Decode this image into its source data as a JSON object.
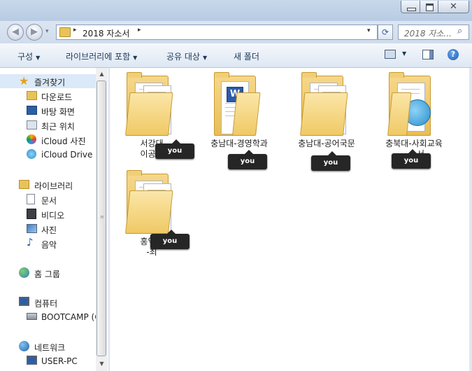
{
  "window": {
    "close_glyph": "✕"
  },
  "navigation": {
    "back_glyph": "◀",
    "forward_glyph": "▶",
    "history_glyph": "▾",
    "address": {
      "crumb_arrow": "▸",
      "path": "2018 자소서",
      "dropdown_glyph": "▾"
    },
    "refresh_glyph": "⟳",
    "search": {
      "placeholder": "2018 자소...",
      "icon": "search-icon"
    }
  },
  "command_bar": {
    "items": [
      {
        "label": "구성",
        "has_dropdown": true
      },
      {
        "label": "라이브러리에 포함",
        "has_dropdown": true
      },
      {
        "label": "공유 대상",
        "has_dropdown": true
      },
      {
        "label": "새 폴더",
        "has_dropdown": false
      }
    ],
    "dropdown_glyph": "▼",
    "help_label": "?"
  },
  "sidebar": {
    "favorites": {
      "label": "즐겨찾기",
      "icon": "star-icon",
      "items": [
        {
          "label": "다운로드",
          "icon": "download-icon"
        },
        {
          "label": "바탕 화면",
          "icon": "desktop-icon"
        },
        {
          "label": "최근 위치",
          "icon": "recent-places-icon"
        },
        {
          "label": "iCloud 사진",
          "icon": "icloud-photos-icon"
        },
        {
          "label": "iCloud Drive",
          "icon": "icloud-drive-icon"
        }
      ]
    },
    "libraries": {
      "label": "라이브러리",
      "icon": "library-icon",
      "items": [
        {
          "label": "문서",
          "icon": "documents-icon"
        },
        {
          "label": "비디오",
          "icon": "video-icon"
        },
        {
          "label": "사진",
          "icon": "pictures-icon"
        },
        {
          "label": "음악",
          "icon": "music-icon"
        }
      ]
    },
    "homegroup": {
      "label": "홈 그룹",
      "icon": "homegroup-icon"
    },
    "computer": {
      "label": "컴퓨터",
      "icon": "computer-icon",
      "items": [
        {
          "label": "BOOTCAMP (C",
          "icon": "drive-icon"
        }
      ]
    },
    "network": {
      "label": "네트워크",
      "icon": "network-icon",
      "items": [
        {
          "label": "USER-PC",
          "icon": "pc-icon"
        }
      ]
    },
    "scroll": {
      "up": "▲",
      "down": "▼",
      "grip": "≡"
    }
  },
  "content": {
    "folders": [
      {
        "line1": "서강대",
        "line2": "이공계",
        "overlay": "you",
        "preview": "document"
      },
      {
        "line1": "충남대-경영학과",
        "line2": "",
        "overlay": "you",
        "preview": "word"
      },
      {
        "line1": "충남대-공어국문",
        "line2": "",
        "overlay": "you",
        "preview": "document"
      },
      {
        "line1": "충북대-사회교육",
        "line2": "- 소서",
        "overlay": "you",
        "preview": "globe"
      },
      {
        "line1": "홍익대",
        "line2": "-최",
        "overlay": "you",
        "preview": "document"
      }
    ]
  },
  "colors": {
    "accent": "#1e395b",
    "folder": "#efc965",
    "tooltip": "#262626",
    "selection": "#dbe9f8"
  }
}
